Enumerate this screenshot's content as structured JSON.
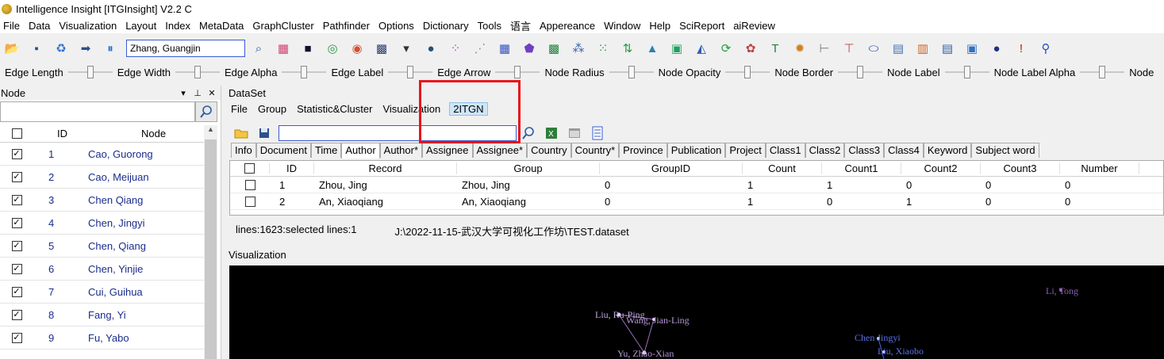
{
  "window": {
    "title": "Intelligence Insight [ITGInsight] V2.2 C"
  },
  "menubar": [
    "File",
    "Data",
    "Visualization",
    "Layout",
    "Index",
    "MetaData",
    "GraphCluster",
    "Pathfinder",
    "Options",
    "Dictionary",
    "Tools",
    "语言",
    "Appereance",
    "Window",
    "Help",
    "SciReport",
    "aiReview"
  ],
  "toolbar": {
    "search_value": "Zhang, Guangjin",
    "icons": [
      "open-folder-icon",
      "save-icon",
      "recycle-icon",
      "forward-icon",
      "pause-icon"
    ],
    "icons_after": [
      "search-icon",
      "color-grid-icon",
      "dark-square-icon",
      "target-icon",
      "spiral-icon",
      "dark-texture-icon",
      "dropdown-icon",
      "blob-icon",
      "bubbles-icon",
      "network-icon",
      "grid-icon",
      "purple-shape-icon",
      "world-map-icon",
      "scatter-icon",
      "dots-icon",
      "arrows-icon",
      "mountain-icon",
      "green-square-icon",
      "blue-mountain-icon",
      "refresh-icon",
      "cluster-icon",
      "text-icon",
      "gear-icon",
      "slider-icon",
      "slider2-icon",
      "ellipse-icon",
      "panel-icon",
      "panel2-icon",
      "doc-icon",
      "panel3-icon",
      "globe-icon",
      "pin-icon",
      "runner-icon"
    ]
  },
  "sliders": [
    "Edge Length",
    "Edge Width",
    "Edge Alpha",
    "Edge Label",
    "Edge Arrow",
    "Node Radius",
    "Node Opacity",
    "Node Border",
    "Node Label",
    "Node Label Alpha",
    "Node"
  ],
  "node_panel": {
    "title": "Node",
    "controls": [
      "▾",
      "⊥",
      "✕"
    ],
    "header": {
      "id": "ID",
      "node": "Node"
    },
    "rows": [
      {
        "id": "1",
        "node": "Cao, Guorong"
      },
      {
        "id": "2",
        "node": "Cao, Meijuan"
      },
      {
        "id": "3",
        "node": "Chen Qiang"
      },
      {
        "id": "4",
        "node": "Chen, Jingyi"
      },
      {
        "id": "5",
        "node": "Chen, Qiang"
      },
      {
        "id": "6",
        "node": "Chen, Yinjie"
      },
      {
        "id": "7",
        "node": "Cui, Guihua"
      },
      {
        "id": "8",
        "node": "Fang, Yi"
      },
      {
        "id": "9",
        "node": "Fu, Yabo"
      }
    ]
  },
  "dataset": {
    "title": "DataSet",
    "menu": [
      "File",
      "Group",
      "Statistic&Cluster",
      "Visualization",
      "2ITGN"
    ],
    "active_menu": "2ITGN",
    "tabs": [
      "Info",
      "Document",
      "Time",
      "Author",
      "Author*",
      "Assignee",
      "Assignee*",
      "Country",
      "Country*",
      "Province",
      "Publication",
      "Project",
      "Class1",
      "Class2",
      "Class3",
      "Class4",
      "Keyword",
      "Subject word"
    ],
    "active_tab": "Author",
    "columns": [
      "ID",
      "Record",
      "Group",
      "GroupID",
      "Count",
      "Count1",
      "Count2",
      "Count3",
      "Number"
    ],
    "rows": [
      [
        "1",
        "Zhou, Jing",
        "Zhou, Jing",
        "0",
        "1",
        "1",
        "0",
        "0",
        "0"
      ],
      [
        "2",
        "An, Xiaoqiang",
        "An, Xiaoqiang",
        "0",
        "1",
        "0",
        "1",
        "0",
        "0"
      ]
    ],
    "status": {
      "lines": "lines:1623:selected lines:1",
      "path": "J:\\2022-11-15-武汉大学可视化工作坊\\TEST.dataset"
    }
  },
  "visualization": {
    "title": "Visualization",
    "labels": [
      "Li, Tong",
      "Liu, Ru-Ping",
      "Wang, Jian-Ling",
      "Yu, Zhao-Xian",
      "Chen Jingyi",
      "Liu, Xiaobo"
    ],
    "colors": {
      "purple": "#9b6fc0",
      "blue": "#4d63e0",
      "background": "#000000"
    }
  },
  "highlight": {
    "color": "#e8141a",
    "target": "2ITGN"
  }
}
